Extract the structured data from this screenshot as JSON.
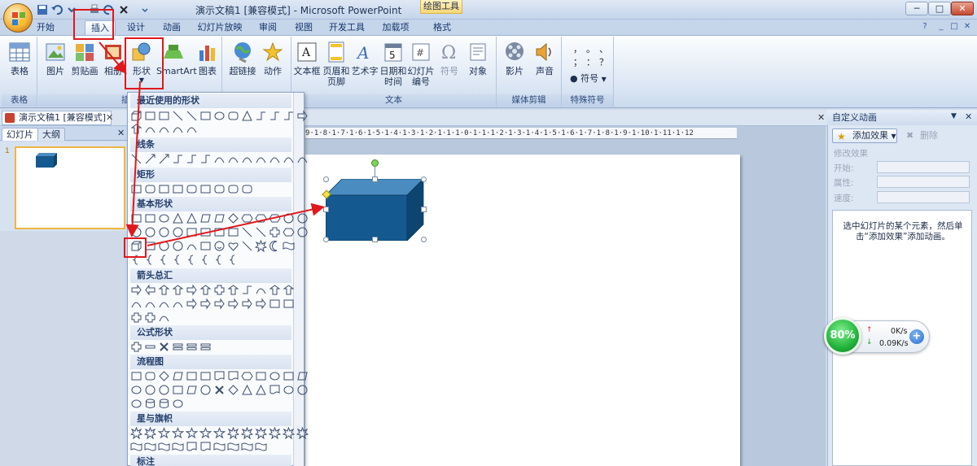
{
  "window": {
    "title": "演示文稿1 [兼容模式] - Microsoft PowerPoint",
    "tools_title": "绘图工具",
    "min_label": "─",
    "max_label": "□",
    "close_label": "✕"
  },
  "tabs": [
    "开始",
    "插入",
    "设计",
    "动画",
    "幻灯片放映",
    "审阅",
    "视图",
    "开发工具",
    "加载项",
    "格式"
  ],
  "ribbon": {
    "groups": {
      "table": "表格",
      "illustrations": "插图",
      "text": "文本",
      "media": "媒体剪辑",
      "symbols": "特殊符号"
    },
    "buttons": {
      "table": "表格",
      "picture": "图片",
      "clipart": "剪贴画",
      "album": "相册",
      "shapes": "形状",
      "smartart": "SmartArt",
      "chart": "图表",
      "hyperlink": "超链接",
      "action": "动作",
      "textbox": "文本框",
      "header_footer": "页眉和页脚",
      "wordart": "艺术字",
      "datetime": "日期和时间",
      "slide_number": "幻灯片编号",
      "symbol": "符号",
      "object": "对象",
      "movie": "影片",
      "sound": "声音",
      "special_symbol": "符号"
    },
    "symbol_cells": [
      "，",
      "。",
      "、",
      "；",
      "：",
      "？"
    ]
  },
  "doc_tab": "演示文稿1 [兼容模式]",
  "left_pane": {
    "tab_slides": "幻灯片",
    "tab_outline": "大纲",
    "slide_index": "1"
  },
  "ruler_text": "9·1·8·1·7·1·6·1·5·1·4·1·3·1·2·1·1·1·0·1·1·1·2·1·3·1·4·1·5·1·6·1·7·1·8·1·9·1·10·1·11·1·12",
  "shapes_menu": {
    "sections": [
      "最近使用的形状",
      "线条",
      "矩形",
      "基本形状",
      "箭头总汇",
      "公式形状",
      "流程图",
      "星与旗帜",
      "标注"
    ]
  },
  "anim_pane": {
    "title": "自定义动画",
    "add_effect": "添加效果",
    "delete": "删除",
    "modify": "修改效果",
    "start": "开始:",
    "property": "属性:",
    "speed": "速度:",
    "hint": "选中幻灯片的某个元素，然后单击“添加效果”添加动画。"
  },
  "net_widget": {
    "percent": "80%",
    "up": "0K/s",
    "down": "0.09K/s",
    "plus": "+"
  },
  "colors": {
    "shape_front": "#14598f",
    "shape_top": "#4a8cbf",
    "shape_side": "#0e4470",
    "highlight": "#e0181c"
  }
}
